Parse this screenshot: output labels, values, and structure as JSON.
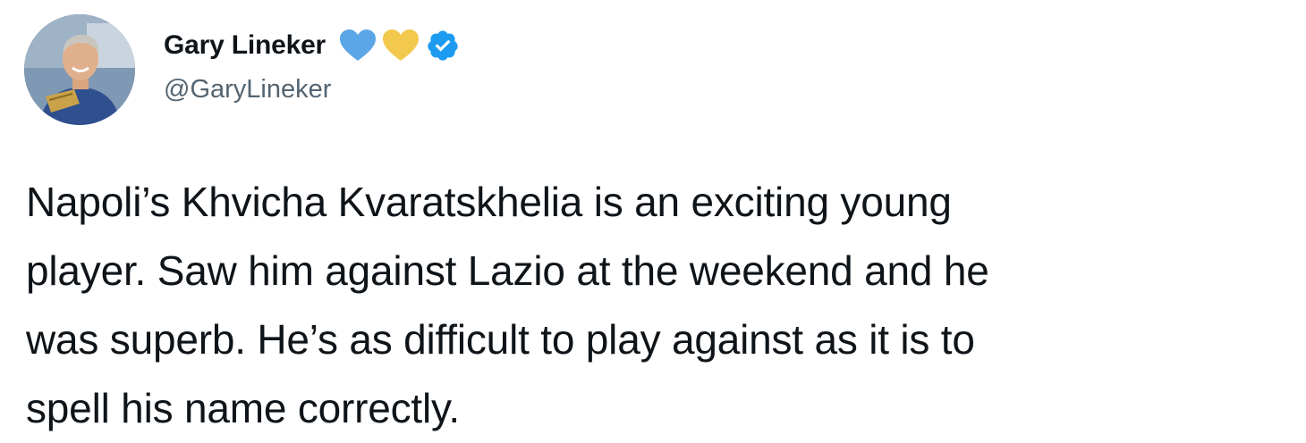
{
  "author": {
    "display_name": "Gary Lineker",
    "handle": "@GaryLineker",
    "badges": [
      {
        "icon": "blue-heart-icon",
        "color": "#5aa6e6"
      },
      {
        "icon": "yellow-heart-icon",
        "color": "#f2c94c"
      },
      {
        "icon": "verified-badge-icon",
        "color": "#1d9bf0"
      }
    ]
  },
  "tweet": {
    "lines": [
      "Napoli’s Khvicha Kvaratskhelia is an exciting young",
      "player. Saw him against Lazio at the weekend and he",
      "was superb. He’s as difficult to play against as it is to",
      "spell his name correctly."
    ]
  },
  "colors": {
    "text_primary": "#0f1419",
    "text_secondary": "#536471",
    "verified_blue": "#1d9bf0"
  }
}
